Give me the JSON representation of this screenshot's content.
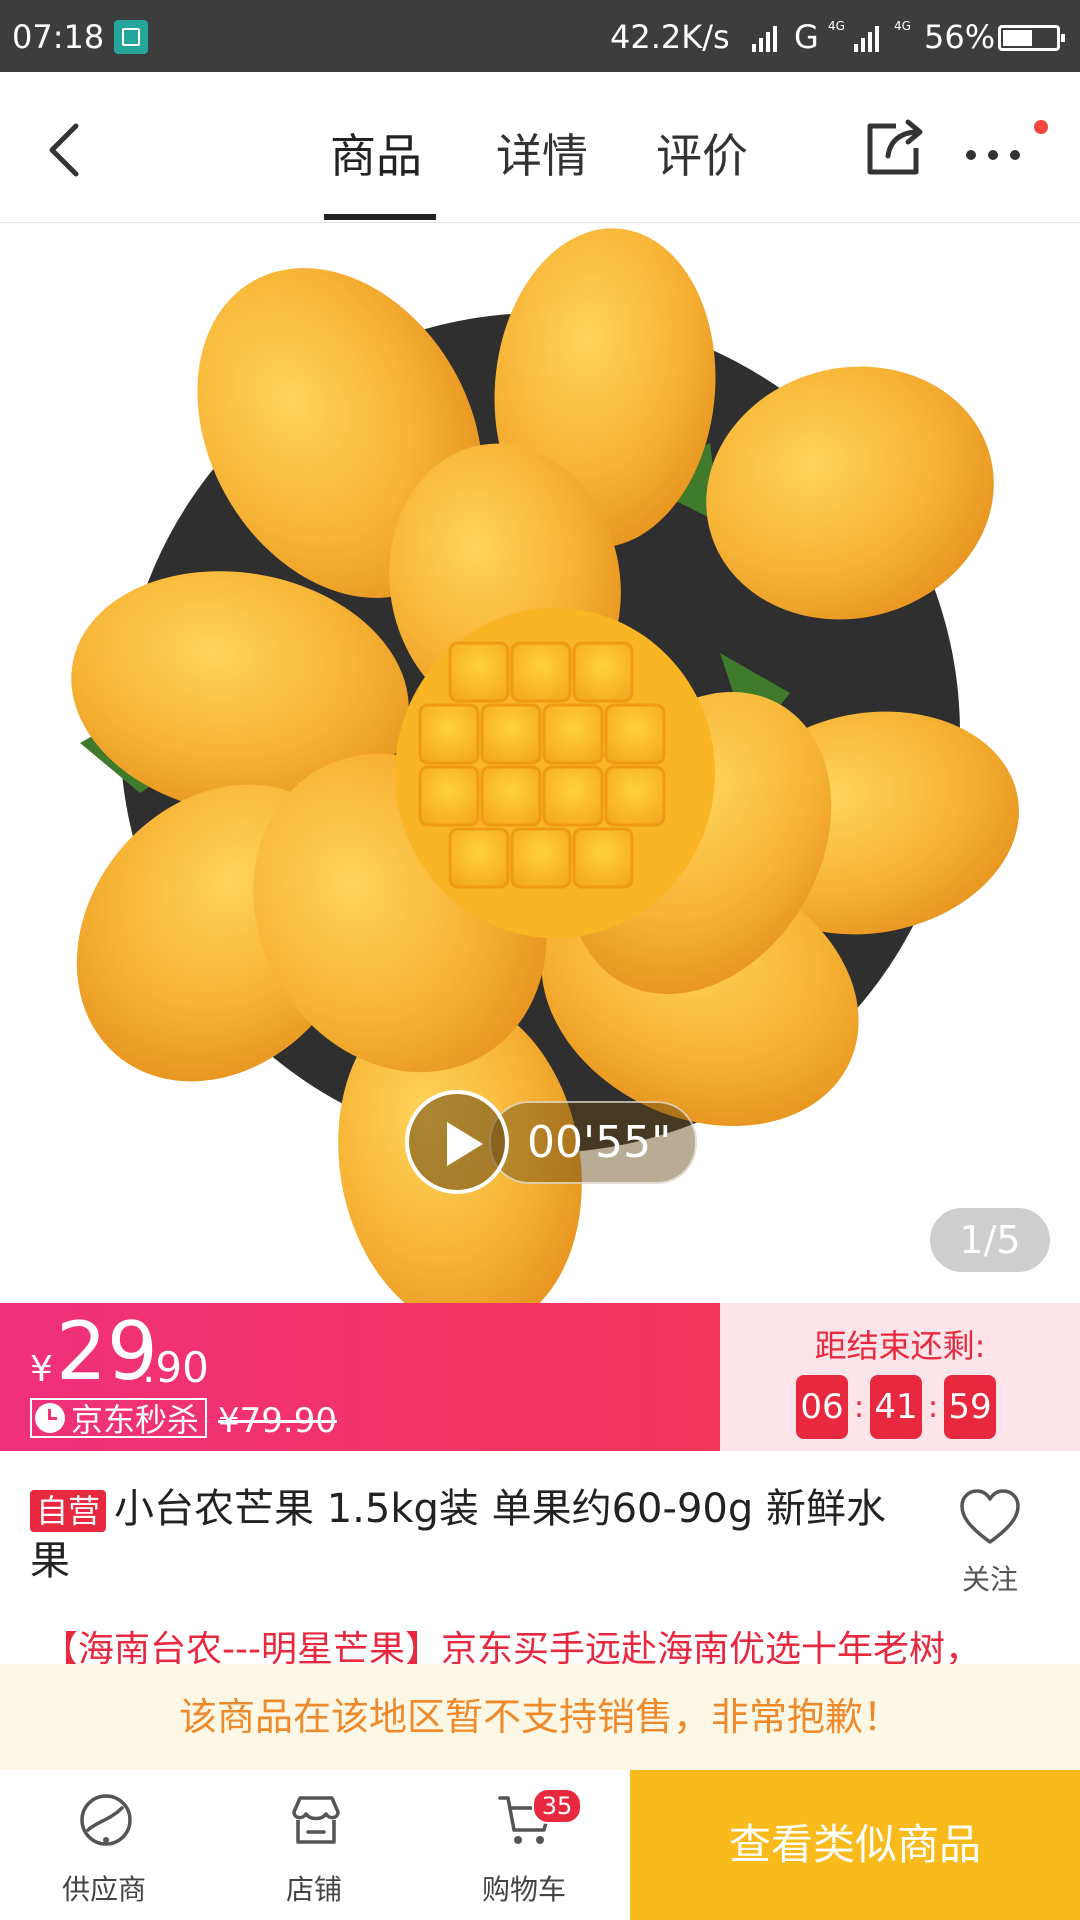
{
  "status_bar": {
    "time": "07:18",
    "speed": "42.2K/s",
    "net1": "G",
    "net2": "4G",
    "battery": "56%",
    "battery_level": 0.56
  },
  "nav": {
    "tabs": [
      {
        "label": "商品"
      },
      {
        "label": "详情"
      },
      {
        "label": "评价"
      }
    ]
  },
  "gallery": {
    "video_duration": "00'55\"",
    "page_indicator": "1/5"
  },
  "price": {
    "currency": "¥",
    "integer": "29",
    "decimal": ".90",
    "flash_tag": "京东秒杀",
    "original": "¥79.90"
  },
  "countdown": {
    "label": "距结束还剩:",
    "hours": "06",
    "minutes": "41",
    "seconds": "59",
    "sep": ":"
  },
  "product": {
    "self_badge": "自营",
    "title": "小台农芒果 1.5kg装 单果约60-90g 新鲜水果",
    "follow_label": "关注",
    "promo": "【海南台农---明星芒果】京东买手远赴海南优选十年老树，"
  },
  "notice": "该商品在该地区暂不支持销售，非常抱歉！",
  "bottom": {
    "supplier": "供应商",
    "shop": "店铺",
    "cart": "购物车",
    "cart_count": "35",
    "similar_button": "查看类似商品"
  },
  "colors": {
    "accent": "#e8283f",
    "price_gradient_start": "#f0307a",
    "cta": "#f9bb1c",
    "notice_text": "#ee8a2c"
  }
}
